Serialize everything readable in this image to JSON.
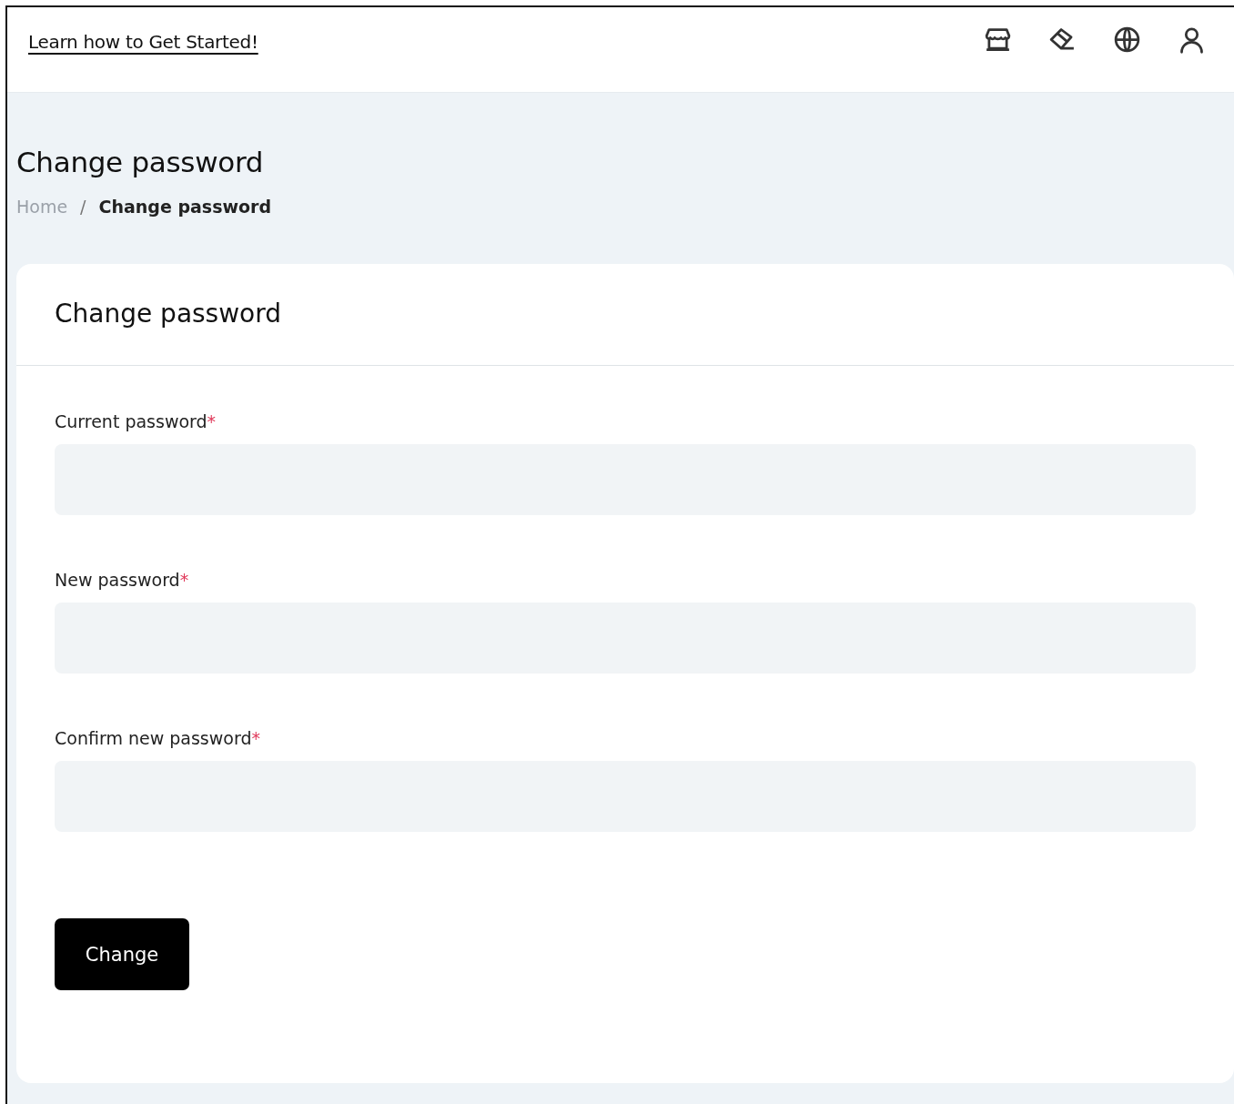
{
  "header": {
    "link": "Learn how to Get Started!",
    "icons": [
      {
        "kind": "store"
      },
      {
        "kind": "eraser"
      },
      {
        "kind": "globe"
      },
      {
        "kind": "user"
      }
    ]
  },
  "page": {
    "title": "Change password",
    "breadcrumb": [
      {
        "label": "Home",
        "selected": false
      },
      {
        "label": "Change password",
        "selected": true
      }
    ],
    "separator": "/"
  },
  "card": {
    "title": "Change password",
    "fields": [
      {
        "label": "Current password",
        "required_mark": "*"
      },
      {
        "label": "New password",
        "required_mark": "*"
      },
      {
        "label": "Confirm new password",
        "required_mark": "*"
      }
    ],
    "button": "Change"
  }
}
